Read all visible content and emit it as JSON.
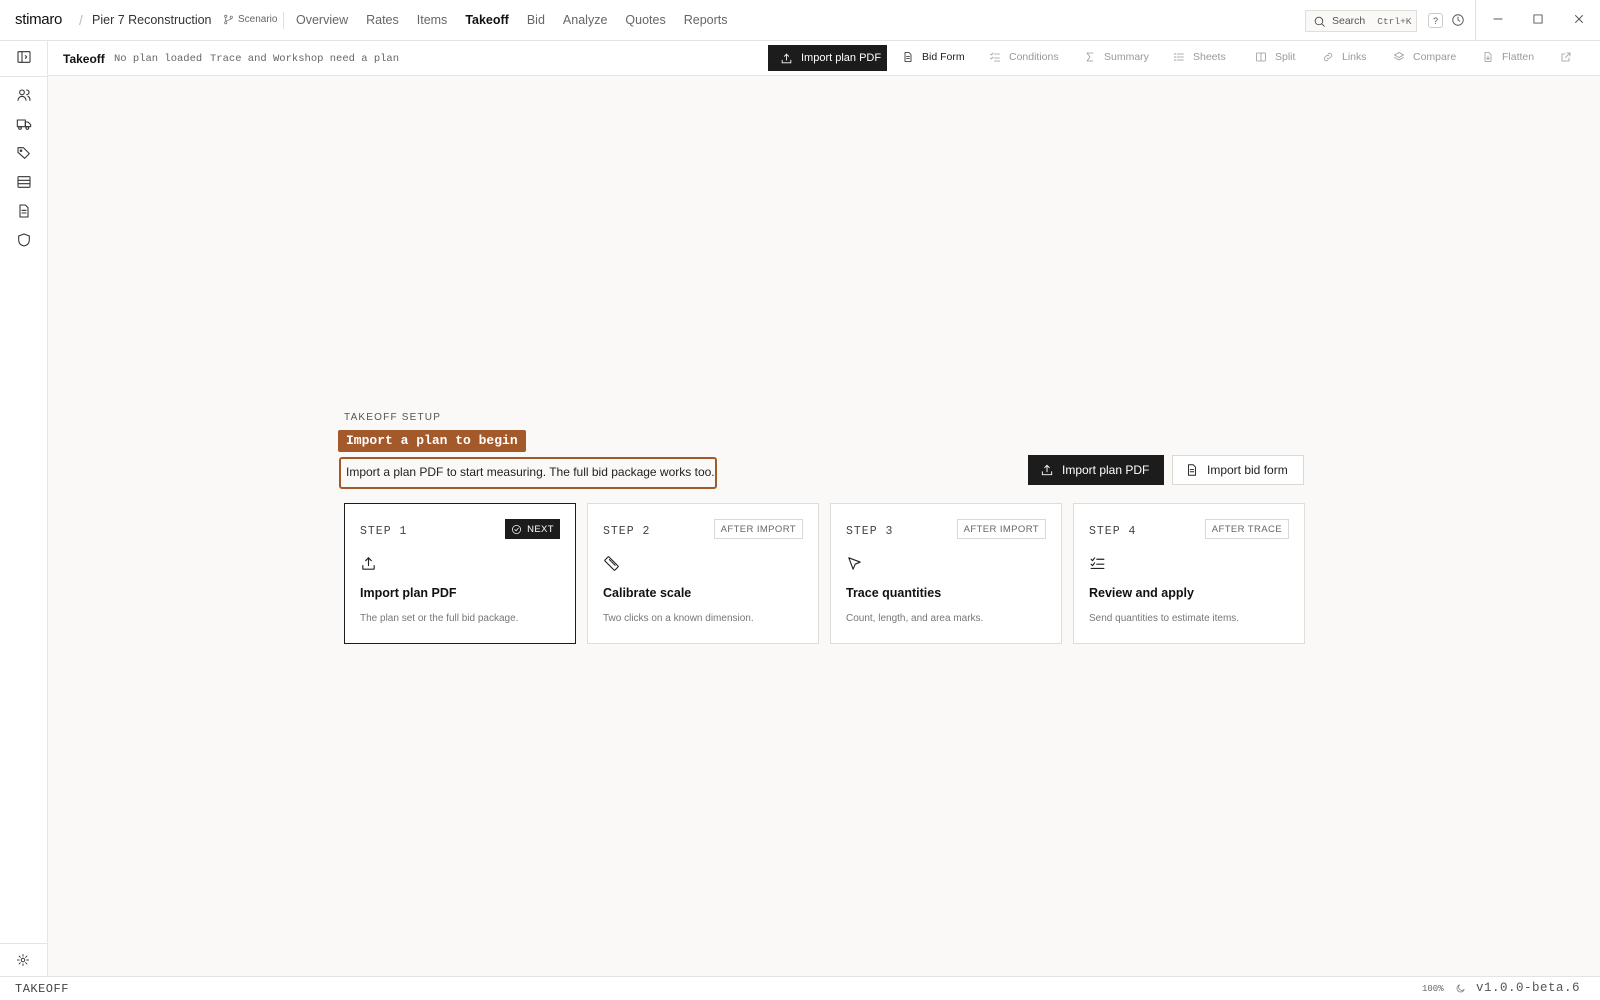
{
  "app": {
    "logo": "stimaro",
    "breadcrumb_sep": "/",
    "project": "Pier 7 Reconstruction",
    "scenario": "Scenario"
  },
  "nav": [
    {
      "label": "Overview",
      "active": false
    },
    {
      "label": "Rates",
      "active": false
    },
    {
      "label": "Items",
      "active": false
    },
    {
      "label": "Takeoff",
      "active": true
    },
    {
      "label": "Bid",
      "active": false
    },
    {
      "label": "Analyze",
      "active": false
    },
    {
      "label": "Quotes",
      "active": false
    },
    {
      "label": "Reports",
      "active": false
    }
  ],
  "search": {
    "label": "Search",
    "shortcut": "Ctrl+K"
  },
  "help": "?",
  "subbar": {
    "title": "Takeoff",
    "status_1": "No plan loaded",
    "status_2": "Trace and Workshop need a plan",
    "import_label": "Import plan PDF",
    "tools": [
      {
        "label": "Bid Form",
        "icon": "document-icon",
        "enabled": true
      },
      {
        "label": "Conditions",
        "icon": "checklist-icon",
        "enabled": false
      },
      {
        "label": "Summary",
        "icon": "sigma-icon",
        "enabled": false
      },
      {
        "label": "Sheets",
        "icon": "list-icon",
        "enabled": false
      },
      {
        "label": "Split",
        "icon": "columns-icon",
        "enabled": false
      },
      {
        "label": "Links",
        "icon": "link-icon",
        "enabled": false
      },
      {
        "label": "Compare",
        "icon": "layers-icon",
        "enabled": false
      },
      {
        "label": "Flatten",
        "icon": "file-down-icon",
        "enabled": false
      }
    ]
  },
  "rail": [
    "sidebar-toggle-icon",
    "users-icon",
    "truck-icon",
    "tags-icon",
    "table-icon",
    "document-icon",
    "shield-icon",
    "gear-icon"
  ],
  "setup": {
    "eyebrow": "TAKEOFF SETUP",
    "title": "Import a plan to begin",
    "description": "Import a plan PDF to start measuring. The full bid package works too.",
    "primary_button": "Import plan PDF",
    "secondary_button": "Import bid form",
    "steps": [
      {
        "step": "STEP 1",
        "badge": "NEXT",
        "title": "Import plan PDF",
        "desc": "The plan set or the full bid package.",
        "icon": "upload-icon",
        "active": true
      },
      {
        "step": "STEP 2",
        "badge": "AFTER IMPORT",
        "title": "Calibrate scale",
        "desc": "Two clicks on a known dimension.",
        "icon": "ruler-icon",
        "active": false
      },
      {
        "step": "STEP 3",
        "badge": "AFTER IMPORT",
        "title": "Trace quantities",
        "desc": "Count, length, and area marks.",
        "icon": "cursor-icon",
        "active": false
      },
      {
        "step": "STEP 4",
        "badge": "AFTER TRACE",
        "title": "Review and apply",
        "desc": "Send quantities to estimate items.",
        "icon": "checklist-icon",
        "active": false
      }
    ]
  },
  "statusbar": {
    "mode": "TAKEOFF",
    "zoom": "100%",
    "version": "v1.0.0-beta.6"
  }
}
